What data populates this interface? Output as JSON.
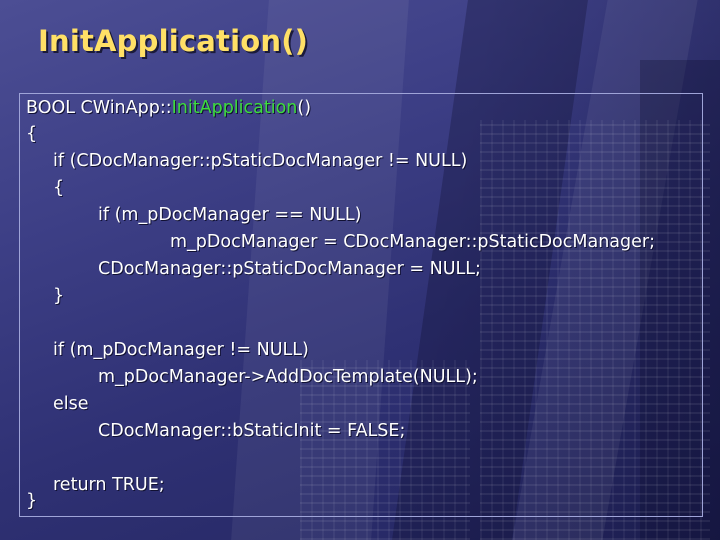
{
  "slide": {
    "title": "InitApplication()"
  },
  "code": {
    "signature": {
      "prefix": "BOOL CWinApp::",
      "function": "InitApplication",
      "suffix": "()"
    },
    "lines": [
      "{",
      "if (CDocManager::pStaticDocManager != NULL)",
      "{",
      "if (m_pDocManager == NULL)",
      "m_pDocManager = CDocManager::pStaticDocManager;",
      "CDocManager::pStaticDocManager = NULL;",
      "}",
      "if (m_pDocManager != NULL)",
      "m_pDocManager->AddDocTemplate(NULL);",
      "else",
      "CDocManager::bStaticInit = FALSE;",
      "return TRUE;",
      "}"
    ]
  },
  "colors": {
    "title": "#ffe066",
    "code_text": "#ffffff",
    "highlight": "#3ddc3d",
    "background": "#3d3f86",
    "border": "#9fa4d8"
  }
}
